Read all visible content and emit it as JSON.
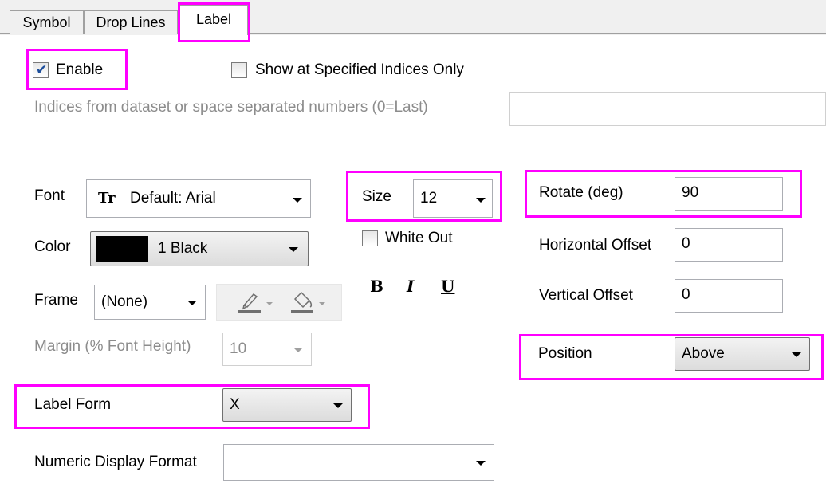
{
  "tabs": [
    "Symbol",
    "Drop Lines",
    "Label"
  ],
  "enable": {
    "label": "Enable",
    "checked": true
  },
  "show_indices": {
    "label": "Show at Specified Indices Only",
    "checked": false
  },
  "indices": {
    "label": "Indices from dataset or space separated numbers (0=Last)",
    "value": ""
  },
  "font": {
    "label": "Font",
    "icon_glyph": "Tr",
    "value": "Default: Arial"
  },
  "size": {
    "label": "Size",
    "value": "12"
  },
  "rotate": {
    "label": "Rotate (deg)",
    "value": "90"
  },
  "color": {
    "label": "Color",
    "value": "1 Black",
    "swatch": "#000000"
  },
  "white_out": {
    "label": "White Out",
    "checked": false
  },
  "horizontal_offset": {
    "label": "Horizontal Offset",
    "value": "0"
  },
  "vertical_offset": {
    "label": "Vertical Offset",
    "value": "0"
  },
  "frame": {
    "label": "Frame",
    "value": "(None)"
  },
  "format_buttons": {
    "bold": "B",
    "italic": "I",
    "underline": "U"
  },
  "margin": {
    "label": "Margin (% Font Height)",
    "value": "10"
  },
  "position": {
    "label": "Position",
    "value": "Above"
  },
  "label_form": {
    "label": "Label Form",
    "value": "X"
  },
  "numeric_format": {
    "label": "Numeric Display Format",
    "value": ""
  },
  "highlight_color": "#ff00ff"
}
